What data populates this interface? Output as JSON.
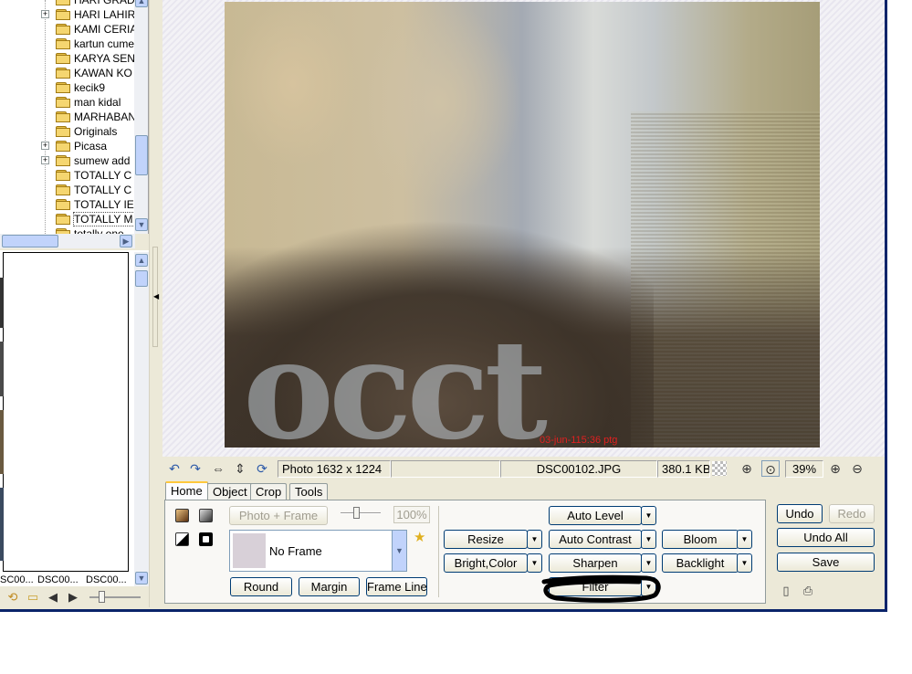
{
  "folder_tree": {
    "items": [
      {
        "label": "HARI GRAD",
        "expandable": false
      },
      {
        "label": "HARI LAHIR",
        "expandable": true
      },
      {
        "label": "KAMI CERIA",
        "expandable": false
      },
      {
        "label": "kartun cume",
        "expandable": false
      },
      {
        "label": "KARYA SENI",
        "expandable": false
      },
      {
        "label": "KAWAN KO",
        "expandable": false
      },
      {
        "label": "kecik9",
        "expandable": false
      },
      {
        "label": "man kidal",
        "expandable": false
      },
      {
        "label": "MARHABAN",
        "expandable": false
      },
      {
        "label": "Originals",
        "expandable": false
      },
      {
        "label": "Picasa",
        "expandable": true
      },
      {
        "label": "sumew add",
        "expandable": true
      },
      {
        "label": "TOTALLY C",
        "expandable": false
      },
      {
        "label": "TOTALLY C",
        "expandable": false
      },
      {
        "label": "TOTALLY IE",
        "expandable": false
      },
      {
        "label": "TOTALLY M",
        "expandable": false
      },
      {
        "label": "totally one",
        "expandable": false
      }
    ],
    "expand_glyph": "+"
  },
  "thumbnails": {
    "captions": [
      "SC00...",
      "DSC00...",
      "DSC00..."
    ]
  },
  "toolbar_left_bottom": {
    "icons": [
      "rotate-icon",
      "open-folder-icon",
      "back-icon",
      "forward-icon"
    ]
  },
  "viewer": {
    "photo_stamp": "03-jun-115:36 ptg",
    "photo_letters": "occt"
  },
  "infobar": {
    "dimensions": "Photo 1632 x 1224",
    "blank_1": "",
    "blank_2": "",
    "filename": "DSC00102.JPG",
    "filesize": "380.1 KB",
    "zoom": "39%",
    "icons": [
      "rotate-left-icon",
      "rotate-right-icon",
      "fit-width-icon",
      "fit-height-icon",
      "refresh-icon",
      "checker-icon",
      "actual-size-icon",
      "fit-window-icon",
      "zoom-in-icon",
      "zoom-out-icon"
    ]
  },
  "tabs": [
    "Home",
    "Object",
    "Crop",
    "Tools"
  ],
  "home_panel": {
    "photo_frame_label": "Photo + Frame",
    "frame_percent": "100%",
    "frame_combo_value": "No Frame",
    "round_label": "Round",
    "margin_label": "Margin",
    "frame_line_label": "Frame Line",
    "auto_level_label": "Auto Level",
    "resize_label": "Resize",
    "auto_contrast_label": "Auto Contrast",
    "bloom_label": "Bloom",
    "bright_color_label": "Bright,Color",
    "sharpen_label": "Sharpen",
    "backlight_label": "Backlight",
    "filter_label": "Filter",
    "dropdown_glyph": "▼"
  },
  "right_panel": {
    "undo_label": "Undo",
    "redo_label": "Redo",
    "undo_all_label": "Undo All",
    "save_label": "Save"
  },
  "colors": {
    "window_face": "#ece9d8",
    "frame_border": "#0a246a",
    "button_border": "#003c74",
    "tab_highlight": "#ffc83c",
    "stamp_red": "#e02020"
  }
}
